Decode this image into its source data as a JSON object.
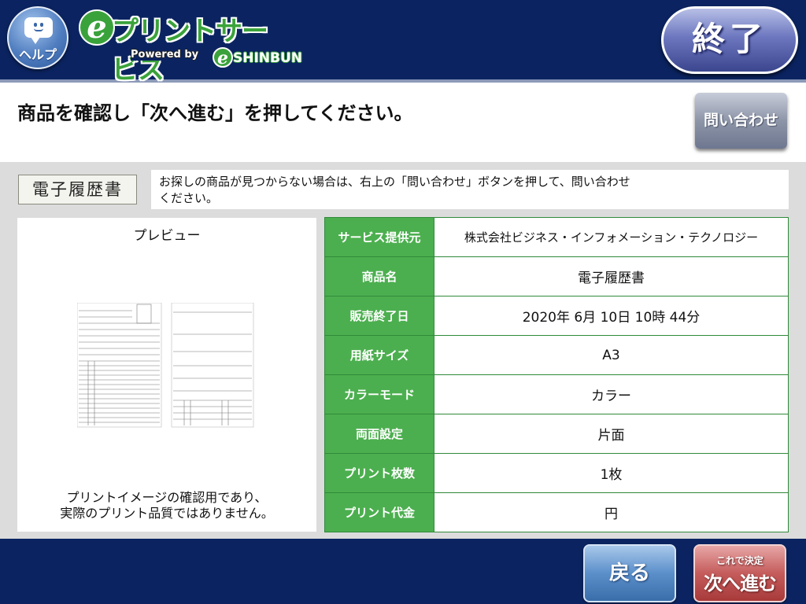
{
  "header": {
    "help_label": "ヘルプ",
    "logo_title": "プリントサービス",
    "logo_powered": "Powered by",
    "logo_shinbun": "SHINBUN",
    "end_button": "終了"
  },
  "instruction": {
    "text": "商品を確認し「次へ進む」を押してください。",
    "inquiry_button": "問い合わせ"
  },
  "product": {
    "tag": "電子履歴書",
    "notice_line1": "お探しの商品が見つからない場合は、右上の「問い合わせ」ボタンを押して、問い合わせ",
    "notice_line2": "ください。"
  },
  "preview": {
    "title": "プレビュー",
    "note_line1": "プリントイメージの確認用であり、",
    "note_line2": "実際のプリント品質ではありません。"
  },
  "details": {
    "rows": [
      {
        "label": "サービス提供元",
        "value": "株式会社ビジネス・インフォメーション・テクノロジー"
      },
      {
        "label": "商品名",
        "value": "電子履歴書"
      },
      {
        "label": "販売終了日",
        "value": "2020年 6月 10日 10時 44分"
      },
      {
        "label": "用紙サイズ",
        "value": "A3"
      },
      {
        "label": "カラーモード",
        "value": "カラー"
      },
      {
        "label": "両面設定",
        "value": "片面"
      },
      {
        "label": "プリント枚数",
        "value": "1枚"
      },
      {
        "label": "プリント代金",
        "value": "円"
      }
    ]
  },
  "footer": {
    "back_button": "戻る",
    "next_sub": "これで決定",
    "next_main": "次へ進む"
  },
  "colors": {
    "header_bg": "#0b2461",
    "table_key_bg": "#4caf4f",
    "back_button": "#5b8fca",
    "next_button": "#c55c5c"
  }
}
